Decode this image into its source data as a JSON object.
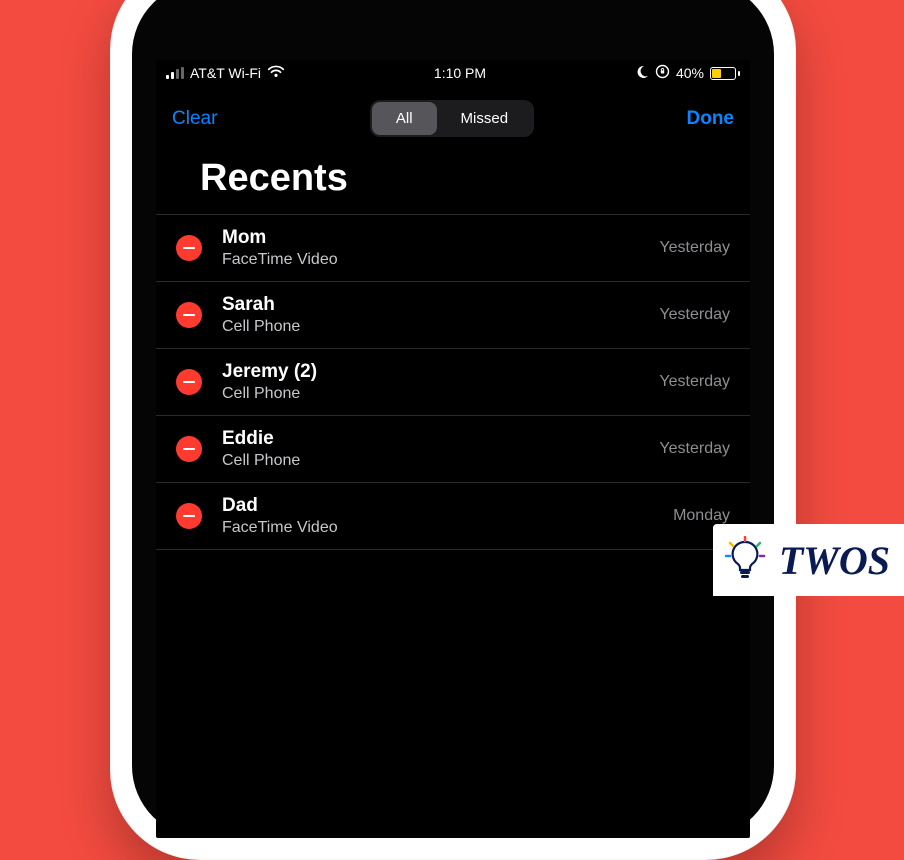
{
  "status": {
    "carrier": "AT&T Wi-Fi",
    "time": "1:10 PM",
    "battery_pct": "40%"
  },
  "nav": {
    "clear": "Clear",
    "done": "Done",
    "seg_all": "All",
    "seg_missed": "Missed"
  },
  "title": "Recents",
  "rows": [
    {
      "name": "Mom",
      "sub": "FaceTime Video",
      "time": "Yesterday"
    },
    {
      "name": "Sarah",
      "sub": "Cell Phone",
      "time": "Yesterday"
    },
    {
      "name": "Jeremy (2)",
      "sub": "Cell Phone",
      "time": "Yesterday"
    },
    {
      "name": "Eddie",
      "sub": "Cell Phone",
      "time": "Yesterday"
    },
    {
      "name": "Dad",
      "sub": "FaceTime Video",
      "time": "Monday"
    }
  ],
  "watermark": {
    "text": "TWOS"
  }
}
